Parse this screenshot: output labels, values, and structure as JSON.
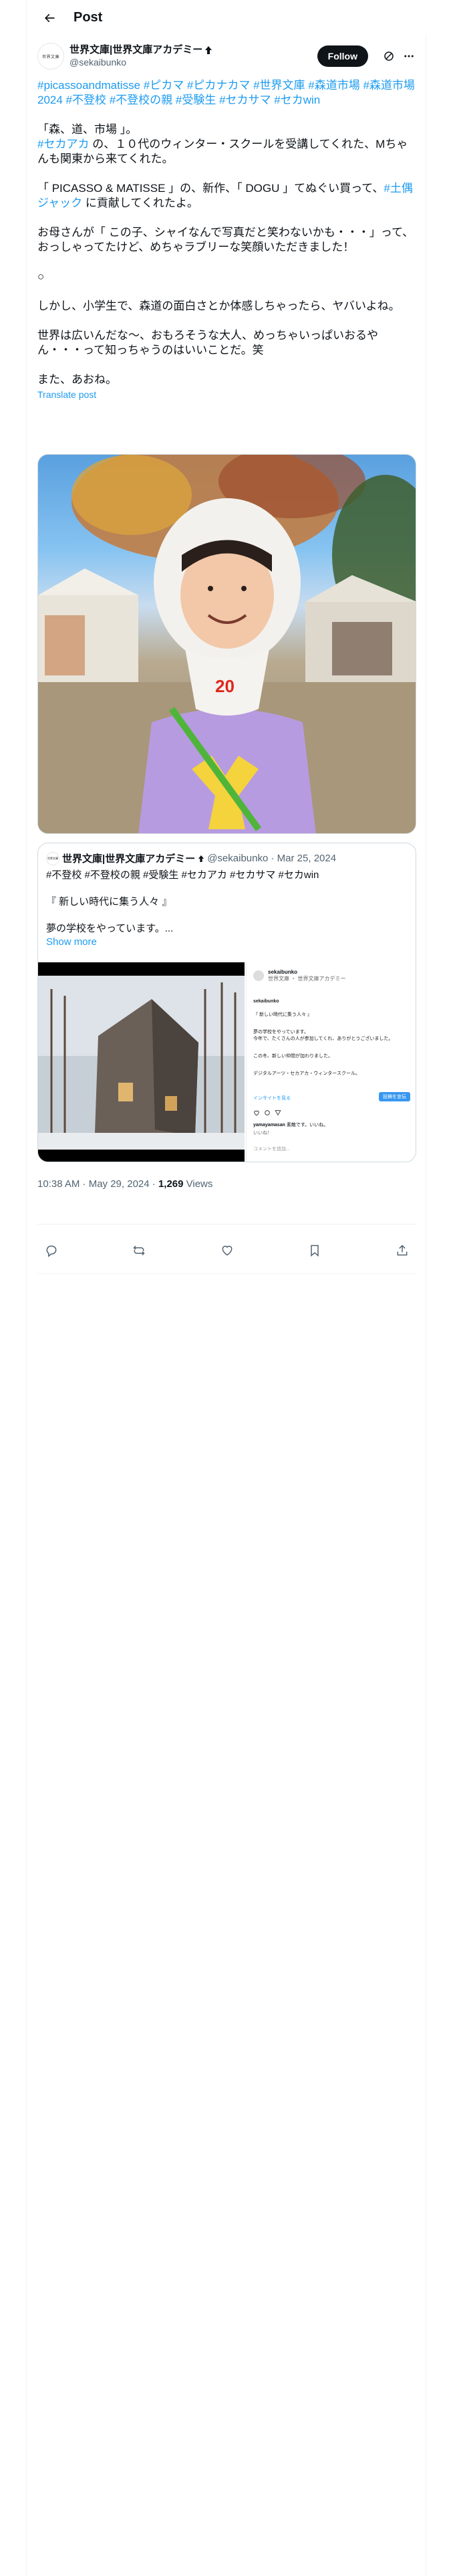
{
  "header": {
    "title": "Post"
  },
  "author": {
    "display_name": "世界文庫|世界文庫アカデミー",
    "handle": "@sekaibunko",
    "avatar_text": "世界文庫",
    "follow_label": "Follow"
  },
  "post": {
    "hashtags": "#picassoandmatisse #ピカマ #ピカナカマ #世界文庫 #森道市場 #森道市場2024 #不登校 #不登校の親 #受験生 #セカサマ #セカwin",
    "line1": "「森、道、市場 」。",
    "line2_link": "#セカアカ",
    "line2_rest": " の、１０代のウィンター・スクールを受講してくれた、Mちゃんも関東から来てくれた。",
    "line3_pre": "「 PICASSO & MATISSE 」の、新作、「 DOGU 」てぬぐい買って、",
    "line3_link": "#土偶ジャック",
    "line3_post": " に貢献してくれたよ。",
    "line4": "お母さんが「 この子、シャイなんで写真だと笑わないかも・・・」って、おっしゃってたけど、めちゃラブリーな笑顔いただきました！",
    "line5": "○",
    "line6": "しかし、小学生で、森道の面白さとか体感しちゃったら、ヤバいよね。",
    "line7": "世界は広いんだな〜、おもろそうな大人、めっちゃいっぱいおるやん・・・って知っちゃうのはいいことだ。笑",
    "line8": "また、あおね。",
    "translate": "Translate post"
  },
  "quote": {
    "avatar_text": "世界文庫",
    "display_name": "世界文庫|世界文庫アカデミー",
    "handle": "@sekaibunko",
    "date": "Mar 25, 2024",
    "tags": "#不登校 #不登校の親 #受験生 #セカアカ #セカサマ #セカwin",
    "line1": "『 新しい時代に集う人々 』",
    "line2": "夢の学校をやっています。...",
    "show_more": "Show more",
    "ig_user": "sekaibunko",
    "ig_sub": "世界文庫 ・ 世界文庫アカデミー",
    "ig_caption_head": "sekaibunko",
    "ig_caption_title": "『 新しい時代に集う人々 』",
    "ig_caption_body": "夢の学校をやっています。\n今年で、たくさんの人が参加してくれ、ありがとうございました。",
    "ig_caption_2": "この冬、新しい仲間が加わりました。",
    "ig_caption_3": "デジタルアーツ・セカアカ・ウィンタースクール。",
    "ig_link": "インサイトを見る",
    "ig_boost": "投稿を宣伝",
    "ig_comment_user": "yamayamasan",
    "ig_comment": "素敵です。いいね。",
    "ig_likes": "いいね！",
    "ig_comment_placeholder": "コメントを追加..."
  },
  "meta": {
    "time": "10:38 AM · May 29, 2024 · ",
    "views_count": "1,269",
    "views_label": " Views"
  },
  "colors": {
    "link": "#1d9bf0",
    "text": "#0f1419",
    "muted": "#536471"
  }
}
